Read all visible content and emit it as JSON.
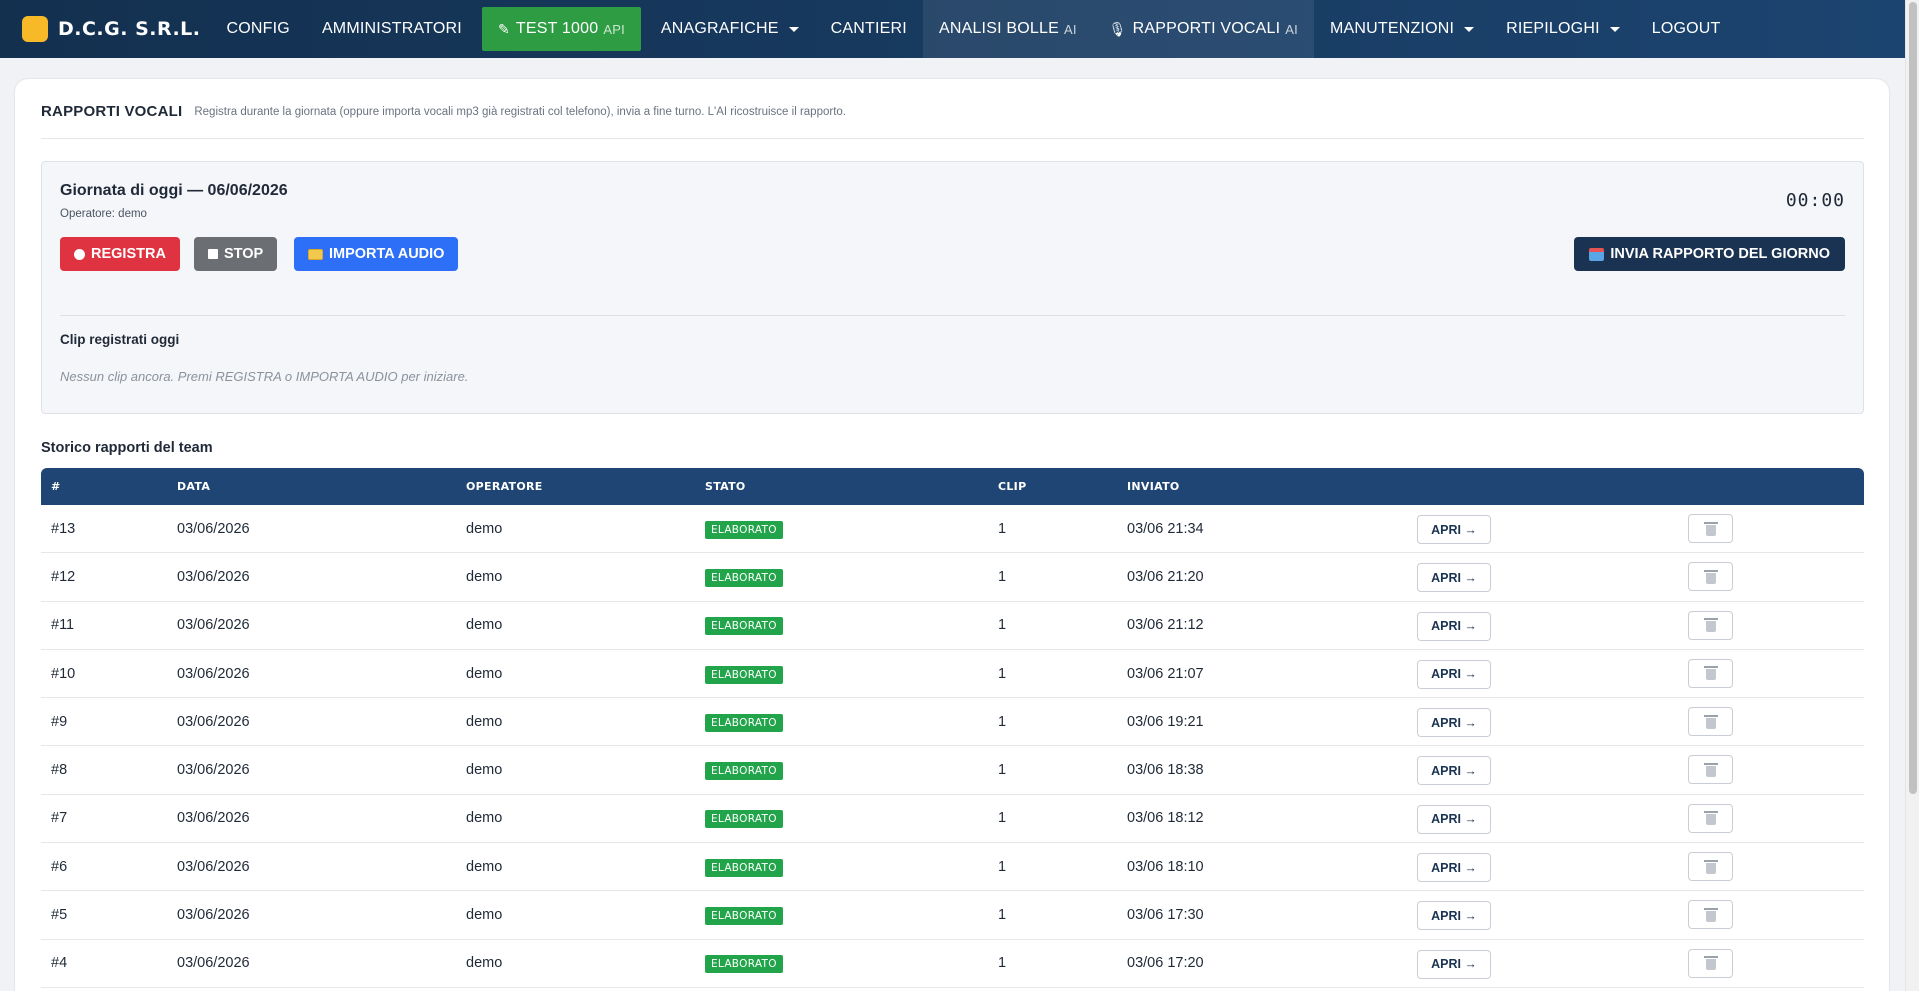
{
  "app": {
    "brand": "D.C.G. S.R.L."
  },
  "nav": {
    "config": "CONFIG",
    "admins": "AMMINISTRATORI",
    "test": "TEST 1000",
    "test_sup": "API",
    "anagrafiche": "ANAGRAFICHE",
    "cantieri": "CANTIERI",
    "analisi": "ANALISI BOLLE",
    "analisi_sup": "AI",
    "rapporti": "RAPPORTI VOCALI",
    "rapporti_sup": "AI",
    "manutenzioni": "MANUTENZIONI",
    "riepiloghi": "RIEPILOGHI",
    "logout": "LOGOUT"
  },
  "page": {
    "title": "RAPPORTI VOCALI",
    "subtitle": "Registra durante la giornata (oppure importa vocali mp3 già registrati col telefono), invia a fine turno. L'AI ricostruisce il rapporto."
  },
  "today": {
    "title": "Giornata di oggi — 06/06/2026",
    "operator": "Operatore: demo",
    "timer": "00:00",
    "record_label": "REGISTRA",
    "stop_label": "STOP",
    "import_label": "IMPORTA AUDIO",
    "send_label": "INVIA RAPPORTO DEL GIORNO",
    "clips_title": "Clip registrati oggi",
    "clips_empty": "Nessun clip ancora. Premi REGISTRA o IMPORTA AUDIO per iniziare."
  },
  "history": {
    "title": "Storico rapporti del team",
    "headers": [
      "#",
      "DATA",
      "OPERATORE",
      "STATO",
      "CLIP",
      "INVIATO"
    ],
    "open_label": "APRI →",
    "rows": [
      {
        "id": "#13",
        "data": "03/06/2026",
        "operatore": "demo",
        "stato": "ELABORATO",
        "clip": "1",
        "inviato": "03/06 21:34"
      },
      {
        "id": "#12",
        "data": "03/06/2026",
        "operatore": "demo",
        "stato": "ELABORATO",
        "clip": "1",
        "inviato": "03/06 21:20"
      },
      {
        "id": "#11",
        "data": "03/06/2026",
        "operatore": "demo",
        "stato": "ELABORATO",
        "clip": "1",
        "inviato": "03/06 21:12"
      },
      {
        "id": "#10",
        "data": "03/06/2026",
        "operatore": "demo",
        "stato": "ELABORATO",
        "clip": "1",
        "inviato": "03/06 21:07"
      },
      {
        "id": "#9",
        "data": "03/06/2026",
        "operatore": "demo",
        "stato": "ELABORATO",
        "clip": "1",
        "inviato": "03/06 19:21"
      },
      {
        "id": "#8",
        "data": "03/06/2026",
        "operatore": "demo",
        "stato": "ELABORATO",
        "clip": "1",
        "inviato": "03/06 18:38"
      },
      {
        "id": "#7",
        "data": "03/06/2026",
        "operatore": "demo",
        "stato": "ELABORATO",
        "clip": "1",
        "inviato": "03/06 18:12"
      },
      {
        "id": "#6",
        "data": "03/06/2026",
        "operatore": "demo",
        "stato": "ELABORATO",
        "clip": "1",
        "inviato": "03/06 18:10"
      },
      {
        "id": "#5",
        "data": "03/06/2026",
        "operatore": "demo",
        "stato": "ELABORATO",
        "clip": "1",
        "inviato": "03/06 17:30"
      },
      {
        "id": "#4",
        "data": "03/06/2026",
        "operatore": "demo",
        "stato": "ELABORATO",
        "clip": "1",
        "inviato": "03/06 17:20"
      }
    ]
  },
  "icons": {
    "pencil": "pencil-icon",
    "mic": "microphone-icon",
    "trash": "trash-icon"
  },
  "colors": {
    "nav_bg": "#1c4470",
    "accent_green": "#2e9c42",
    "record_red": "#e03341",
    "import_blue": "#2d6ff7",
    "badge_green": "#22a54a"
  }
}
